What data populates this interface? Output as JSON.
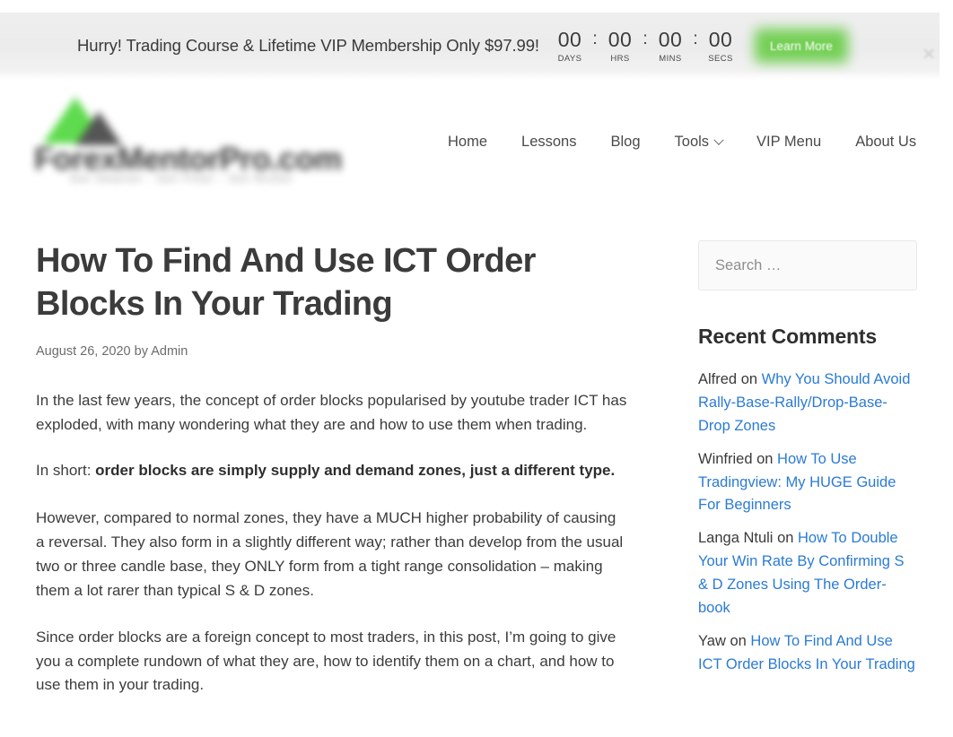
{
  "banner": {
    "message": "Hurry! Trading Course & Lifetime VIP Membership Only $97.99!",
    "countdown": [
      {
        "value": "00",
        "label": "DAYS"
      },
      {
        "value": "00",
        "label": "HRS"
      },
      {
        "value": "00",
        "label": "MINS"
      },
      {
        "value": "00",
        "label": "SECS"
      }
    ],
    "separator": ":",
    "cta_label": "Learn More",
    "cta_color": "#6ece4e",
    "close_icon": "close-icon"
  },
  "header": {
    "logo": {
      "wordmark": "ForexMentorPro.com",
      "tagline": "Get Smarter - Get Fitter - Get Richer",
      "accent_color": "#5edb4e"
    },
    "nav": [
      {
        "label": "Home",
        "has_dropdown": false
      },
      {
        "label": "Lessons",
        "has_dropdown": false
      },
      {
        "label": "Blog",
        "has_dropdown": false
      },
      {
        "label": "Tools",
        "has_dropdown": true
      },
      {
        "label": "VIP Menu",
        "has_dropdown": false
      },
      {
        "label": "About Us",
        "has_dropdown": false
      }
    ]
  },
  "article": {
    "title": "How To Find And Use ICT Order Blocks In Your Trading",
    "date": "August 26, 2020",
    "by_word": "by",
    "author": "Admin",
    "paragraphs": [
      {
        "type": "plain",
        "text": "In the last few years, the concept of order blocks popularised by youtube trader ICT has exploded, with many wondering what they are and how to use them when trading."
      },
      {
        "type": "lead-bold",
        "lead": "In short: ",
        "bold": "order blocks are simply supply and demand zones, just a different type."
      },
      {
        "type": "plain",
        "text": "However, compared to normal zones, they have a MUCH higher probability of causing a reversal. They also form in a slightly different way; rather than develop from the usual two or three candle base, they ONLY form from a tight range consolidation – making them a lot rarer than typical S & D zones."
      },
      {
        "type": "plain",
        "text": "Since order blocks are a foreign concept to most traders, in this post, I’m going to give you a complete rundown of what they are, how to identify them on a chart, and how to use them in your trading."
      }
    ]
  },
  "sidebar": {
    "search": {
      "placeholder": "Search …",
      "value": ""
    },
    "recent_comments": {
      "heading": "Recent Comments",
      "items": [
        {
          "author": "Alfred",
          "on": " on ",
          "post": "Why You Should Avoid Rally-Base-Rally/Drop-Base-Drop Zones"
        },
        {
          "author": "Winfried",
          "on": " on ",
          "post": "How To Use Tradingview: My HUGE Guide For Beginners"
        },
        {
          "author": "Langa Ntuli",
          "on": " on ",
          "post": "How To Double Your Win Rate By Confirming S & D Zones Using The Order-book"
        },
        {
          "author": "Yaw",
          "on": " on ",
          "post": "How To Find And Use ICT Order Blocks In Your Trading"
        }
      ],
      "link_color": "#2b7bd4"
    }
  }
}
